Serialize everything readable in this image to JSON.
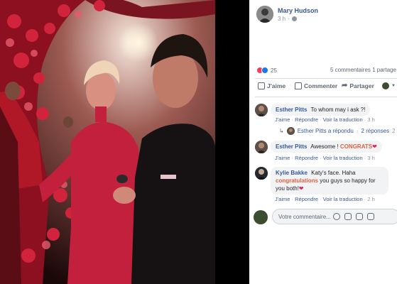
{
  "post": {
    "author": "Mary Hudson",
    "time": "3 h",
    "privacy_icon": "globe-icon"
  },
  "stats": {
    "reaction_count": "25",
    "comments_shares": "5 commentaires 1 partage"
  },
  "actions": {
    "like": "J'aime",
    "comment": "Commenter",
    "share": "Partager"
  },
  "comments": [
    {
      "author": "Esther Pitts",
      "text": "To whom may i ask ?!",
      "like": "J'aime",
      "reply": "Répondre",
      "translate": "Voir la traduction",
      "time": "3 h",
      "reply_summary": {
        "text": "Esther Pitts a répondu",
        "count": "2 réponses",
        "time": "2 h"
      }
    },
    {
      "author": "Esther Pitts",
      "text": "Awesome !",
      "highlight": "CONGRATS",
      "like": "J'aime",
      "reply": "Répondre",
      "translate": "Voir la traduction",
      "time": "3 h"
    },
    {
      "author": "Kylie Bakke",
      "text_before": "Katy's face. Haha",
      "highlight": "congratulations",
      "text_after": "you guys so happy for you both!",
      "like": "J'aime",
      "reply": "Répondre",
      "translate": "Voir la traduction",
      "time": "2 h"
    }
  ],
  "composer": {
    "placeholder": "Votre commentaire..."
  },
  "colors": {
    "link": "#385898",
    "highlight": "#e25f3c",
    "heart": "#e0245e"
  }
}
